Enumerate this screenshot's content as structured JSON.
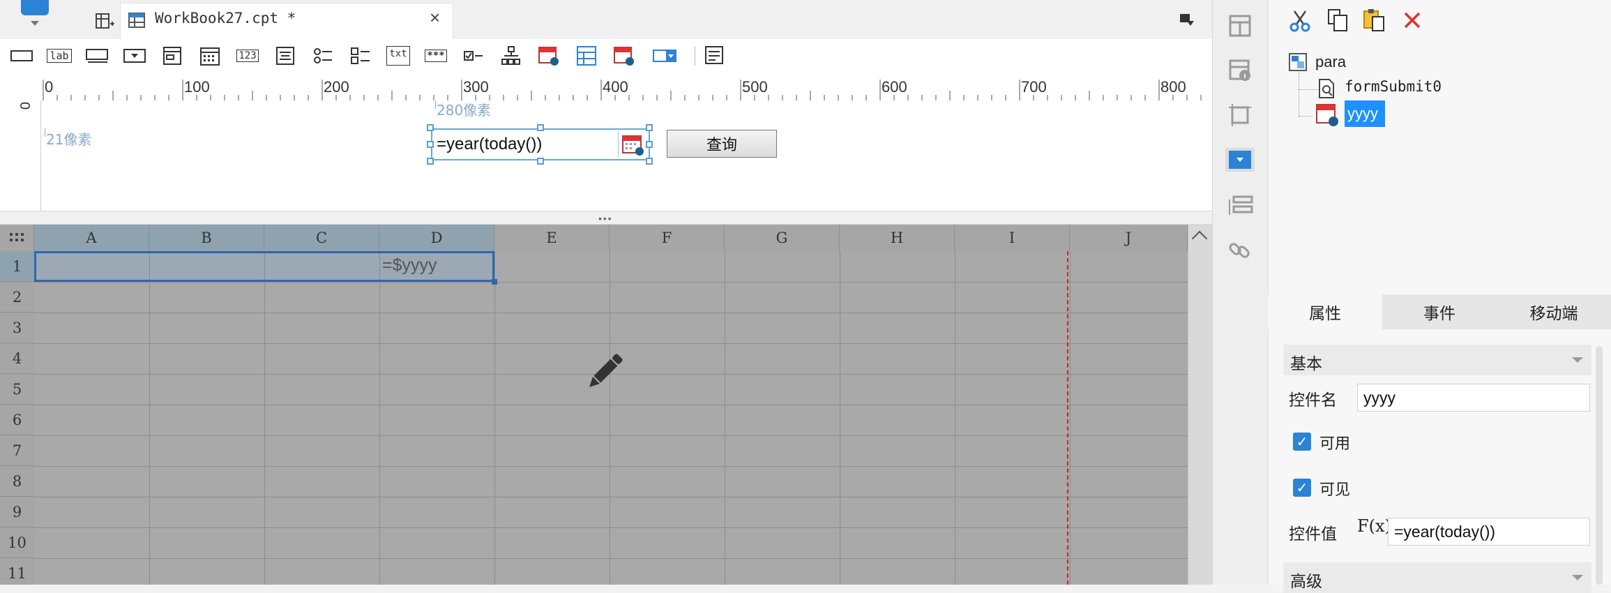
{
  "tab": {
    "title": "WorkBook27.cpt *",
    "close": "×"
  },
  "ruler": {
    "h_labels": [
      "0",
      "100",
      "200",
      "300",
      "400",
      "500",
      "600",
      "700",
      "800"
    ],
    "v_label": "0"
  },
  "param_panel": {
    "width_hint": "280像素",
    "height_hint": "21像素",
    "date_value": "=year(today())",
    "query_button": "查询"
  },
  "grid": {
    "columns": [
      "A",
      "B",
      "C",
      "D",
      "E",
      "F",
      "G",
      "H",
      "I",
      "J"
    ],
    "rows": [
      "1",
      "2",
      "3",
      "4",
      "5",
      "6",
      "7",
      "8",
      "9",
      "10",
      "11"
    ],
    "d1_value": "=$yyyy"
  },
  "widget_tree": {
    "root": "para",
    "children": [
      "formSubmit0",
      "yyyy"
    ],
    "selected": "yyyy"
  },
  "right_tabs": [
    "属性",
    "事件",
    "移动端"
  ],
  "properties": {
    "section_basic": "基本",
    "name_label": "控件名",
    "name_value": "yyyy",
    "enabled_label": "可用",
    "visible_label": "可见",
    "value_label": "控件值",
    "value_formula_icon": "F(x)",
    "value_value": "=year(today())",
    "section_advanced": "高级"
  },
  "toolbar_small_labels": {
    "lab": "lab",
    "num": "123",
    "txt": "txt",
    "pwd": "***"
  },
  "colors": {
    "accent": "#2b83d6",
    "selected_bg": "#1e90ff",
    "page_break": "#cc2222"
  }
}
